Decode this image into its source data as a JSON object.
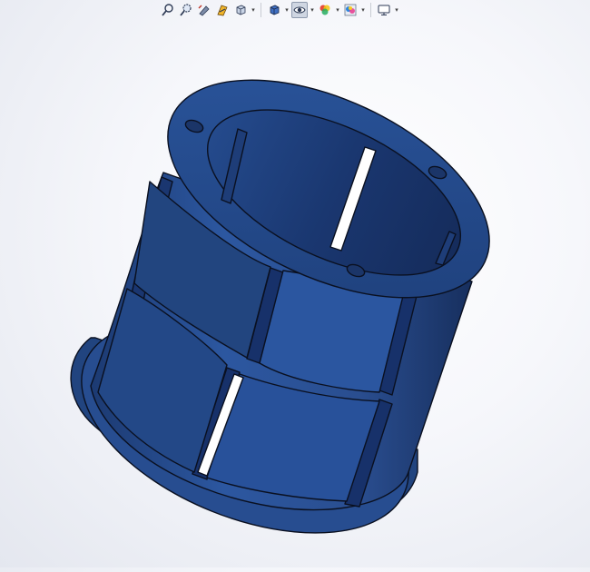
{
  "toolbar": {
    "items": [
      {
        "icon": "zoom-to-fit-icon"
      },
      {
        "icon": "zoom-to-area-icon"
      },
      {
        "icon": "previous-view-icon"
      },
      {
        "icon": "section-view-icon"
      },
      {
        "icon": "view-orientation-icon",
        "dropdown": true
      },
      {
        "icon": "display-style-icon",
        "dropdown": true
      },
      {
        "icon": "hide-show-items-icon",
        "dropdown": true,
        "active": true
      },
      {
        "icon": "edit-appearance-icon",
        "dropdown": true
      },
      {
        "icon": "apply-scene-icon",
        "dropdown": true
      },
      {
        "icon": "view-settings-icon",
        "dropdown": true
      }
    ]
  },
  "model": {
    "color": "#2a4d8f",
    "edge_color": "#0a1020",
    "background": "#f4f5f9"
  }
}
